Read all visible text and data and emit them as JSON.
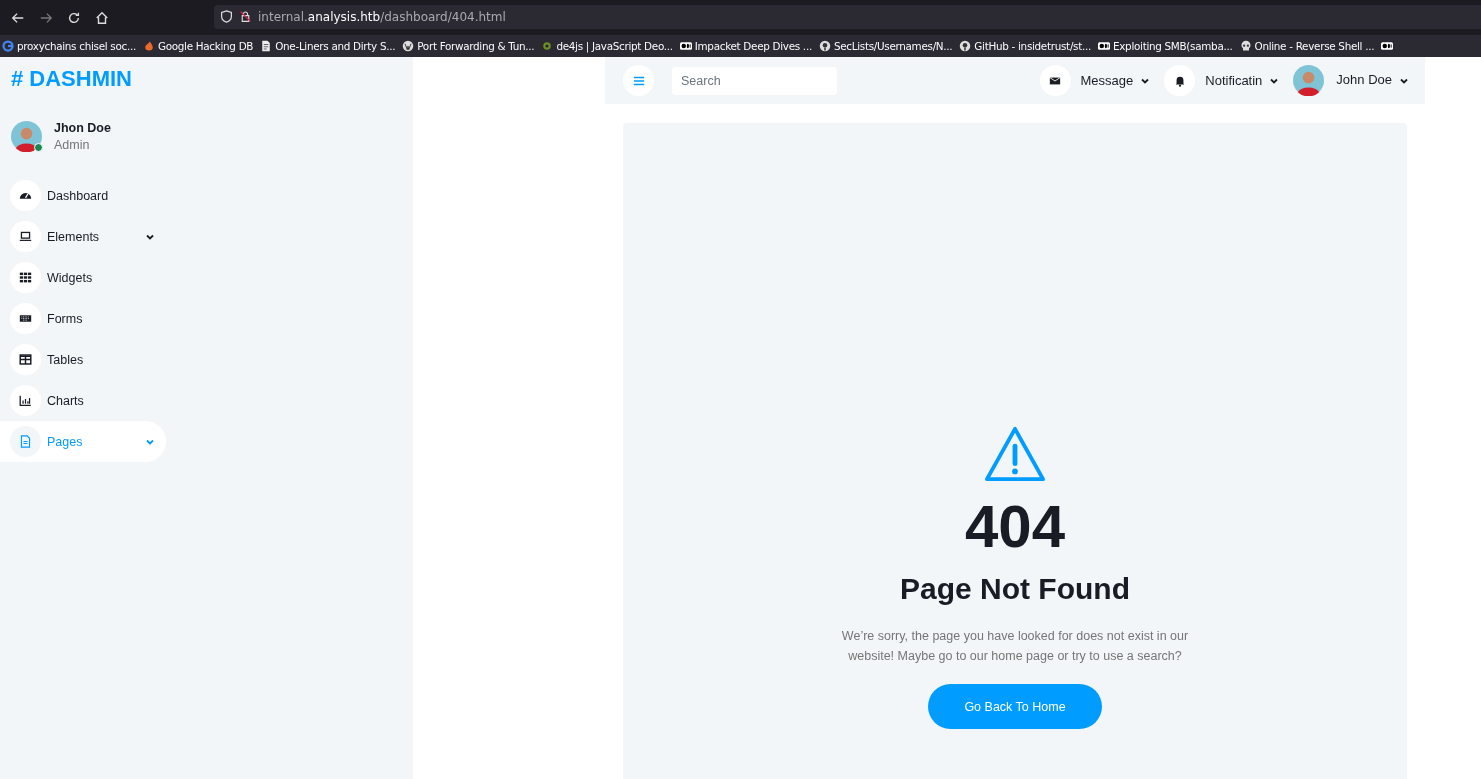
{
  "browser": {
    "url_host": "internal.",
    "url_domain": "analysis.htb",
    "url_path": "/dashboard/404.html",
    "bookmarks": [
      {
        "label": "proxychains chisel soc...",
        "kind": "google"
      },
      {
        "label": "Google Hacking DB",
        "kind": "flame"
      },
      {
        "label": "One-Liners and Dirty S...",
        "kind": "doc"
      },
      {
        "label": "Port Forwarding & Tun...",
        "kind": "wordpress"
      },
      {
        "label": "de4js | JavaScript Deo...",
        "kind": "bug"
      },
      {
        "label": "Impacket Deep Dives ...",
        "kind": "medium"
      },
      {
        "label": "SecLists/Usernames/N...",
        "kind": "github"
      },
      {
        "label": "GitHub - insidetrust/st...",
        "kind": "github"
      },
      {
        "label": "Exploiting SMB(samba...",
        "kind": "medium"
      },
      {
        "label": "Online - Reverse Shell ...",
        "kind": "skull"
      },
      {
        "kind": "medium"
      }
    ]
  },
  "sidebar": {
    "logo": "# DASHMIN",
    "user": {
      "name": "Jhon Doe",
      "role": "Admin"
    },
    "items": [
      {
        "label": "Dashboard",
        "kind": "gauge",
        "selected": false,
        "dropdown": false
      },
      {
        "label": "Elements",
        "kind": "laptop",
        "selected": false,
        "dropdown": true
      },
      {
        "label": "Widgets",
        "kind": "grid",
        "selected": false,
        "dropdown": false
      },
      {
        "label": "Forms",
        "kind": "keyboard",
        "selected": false,
        "dropdown": false
      },
      {
        "label": "Tables",
        "kind": "table",
        "selected": false,
        "dropdown": false
      },
      {
        "label": "Charts",
        "kind": "chart",
        "selected": false,
        "dropdown": false
      },
      {
        "label": "Pages",
        "kind": "file",
        "selected": true,
        "dropdown": true
      }
    ]
  },
  "topbar": {
    "search": {
      "placeholder": "Search"
    },
    "message": "Message",
    "notification": "Notificatin",
    "user": "John Doe"
  },
  "error": {
    "code": "404",
    "title": "Page Not Found",
    "text": "We’re sorry, the page you have looked for does not exist in our website! Maybe go to our home page or try to use a search?",
    "button": "Go Back To Home"
  }
}
